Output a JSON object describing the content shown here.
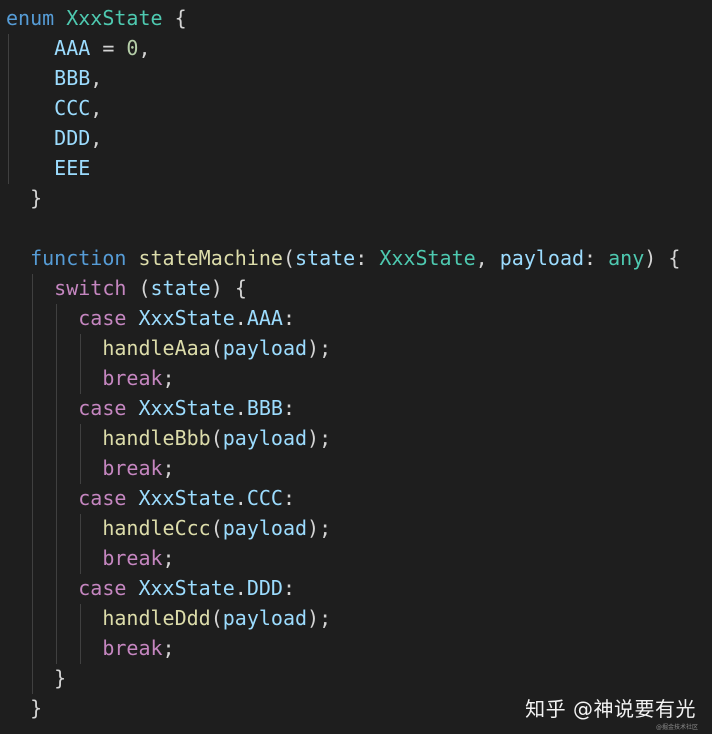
{
  "theme": {
    "background": "#1e1e1e",
    "keyword": "#569cd6",
    "control": "#c586c0",
    "type": "#4ec9b0",
    "function": "#dcdcaa",
    "variable": "#9cdcfe",
    "number": "#b5cea8",
    "punctuation": "#d4d4d4"
  },
  "code": {
    "lines": [
      [
        [
          "kw",
          "enum"
        ],
        [
          "p",
          " "
        ],
        [
          "type",
          "XxxState"
        ],
        [
          "p",
          " {"
        ]
      ],
      [
        [
          "p",
          "    "
        ],
        [
          "var",
          "AAA"
        ],
        [
          "p",
          " = "
        ],
        [
          "num",
          "0"
        ],
        [
          "p",
          ","
        ]
      ],
      [
        [
          "p",
          "    "
        ],
        [
          "var",
          "BBB"
        ],
        [
          "p",
          ","
        ]
      ],
      [
        [
          "p",
          "    "
        ],
        [
          "var",
          "CCC"
        ],
        [
          "p",
          ","
        ]
      ],
      [
        [
          "p",
          "    "
        ],
        [
          "var",
          "DDD"
        ],
        [
          "p",
          ","
        ]
      ],
      [
        [
          "p",
          "    "
        ],
        [
          "var",
          "EEE"
        ]
      ],
      [
        [
          "p",
          "  }"
        ]
      ],
      [
        [
          "p",
          ""
        ]
      ],
      [
        [
          "p",
          "  "
        ],
        [
          "kw",
          "function"
        ],
        [
          "p",
          " "
        ],
        [
          "fn",
          "stateMachine"
        ],
        [
          "p",
          "("
        ],
        [
          "var",
          "state"
        ],
        [
          "p",
          ": "
        ],
        [
          "type",
          "XxxState"
        ],
        [
          "p",
          ", "
        ],
        [
          "var",
          "payload"
        ],
        [
          "p",
          ": "
        ],
        [
          "type",
          "any"
        ],
        [
          "p",
          ") {"
        ]
      ],
      [
        [
          "p",
          "    "
        ],
        [
          "ctl",
          "switch"
        ],
        [
          "p",
          " ("
        ],
        [
          "var",
          "state"
        ],
        [
          "p",
          ") {"
        ]
      ],
      [
        [
          "p",
          "      "
        ],
        [
          "ctl",
          "case"
        ],
        [
          "p",
          " "
        ],
        [
          "var",
          "XxxState"
        ],
        [
          "p",
          "."
        ],
        [
          "var",
          "AAA"
        ],
        [
          "p",
          ":"
        ]
      ],
      [
        [
          "p",
          "        "
        ],
        [
          "fn",
          "handleAaa"
        ],
        [
          "p",
          "("
        ],
        [
          "var",
          "payload"
        ],
        [
          "p",
          ");"
        ]
      ],
      [
        [
          "p",
          "        "
        ],
        [
          "ctl",
          "break"
        ],
        [
          "p",
          ";"
        ]
      ],
      [
        [
          "p",
          "      "
        ],
        [
          "ctl",
          "case"
        ],
        [
          "p",
          " "
        ],
        [
          "var",
          "XxxState"
        ],
        [
          "p",
          "."
        ],
        [
          "var",
          "BBB"
        ],
        [
          "p",
          ":"
        ]
      ],
      [
        [
          "p",
          "        "
        ],
        [
          "fn",
          "handleBbb"
        ],
        [
          "p",
          "("
        ],
        [
          "var",
          "payload"
        ],
        [
          "p",
          ");"
        ]
      ],
      [
        [
          "p",
          "        "
        ],
        [
          "ctl",
          "break"
        ],
        [
          "p",
          ";"
        ]
      ],
      [
        [
          "p",
          "      "
        ],
        [
          "ctl",
          "case"
        ],
        [
          "p",
          " "
        ],
        [
          "var",
          "XxxState"
        ],
        [
          "p",
          "."
        ],
        [
          "var",
          "CCC"
        ],
        [
          "p",
          ":"
        ]
      ],
      [
        [
          "p",
          "        "
        ],
        [
          "fn",
          "handleCcc"
        ],
        [
          "p",
          "("
        ],
        [
          "var",
          "payload"
        ],
        [
          "p",
          ");"
        ]
      ],
      [
        [
          "p",
          "        "
        ],
        [
          "ctl",
          "break"
        ],
        [
          "p",
          ";"
        ]
      ],
      [
        [
          "p",
          "      "
        ],
        [
          "ctl",
          "case"
        ],
        [
          "p",
          " "
        ],
        [
          "var",
          "XxxState"
        ],
        [
          "p",
          "."
        ],
        [
          "var",
          "DDD"
        ],
        [
          "p",
          ":"
        ]
      ],
      [
        [
          "p",
          "        "
        ],
        [
          "fn",
          "handleDdd"
        ],
        [
          "p",
          "("
        ],
        [
          "var",
          "payload"
        ],
        [
          "p",
          ");"
        ]
      ],
      [
        [
          "p",
          "        "
        ],
        [
          "ctl",
          "break"
        ],
        [
          "p",
          ";"
        ]
      ],
      [
        [
          "p",
          "    }"
        ]
      ],
      [
        [
          "p",
          "  }"
        ]
      ]
    ]
  },
  "watermark": {
    "text": "知乎 @神说要有光",
    "subtext": "@掘金技术社区"
  }
}
